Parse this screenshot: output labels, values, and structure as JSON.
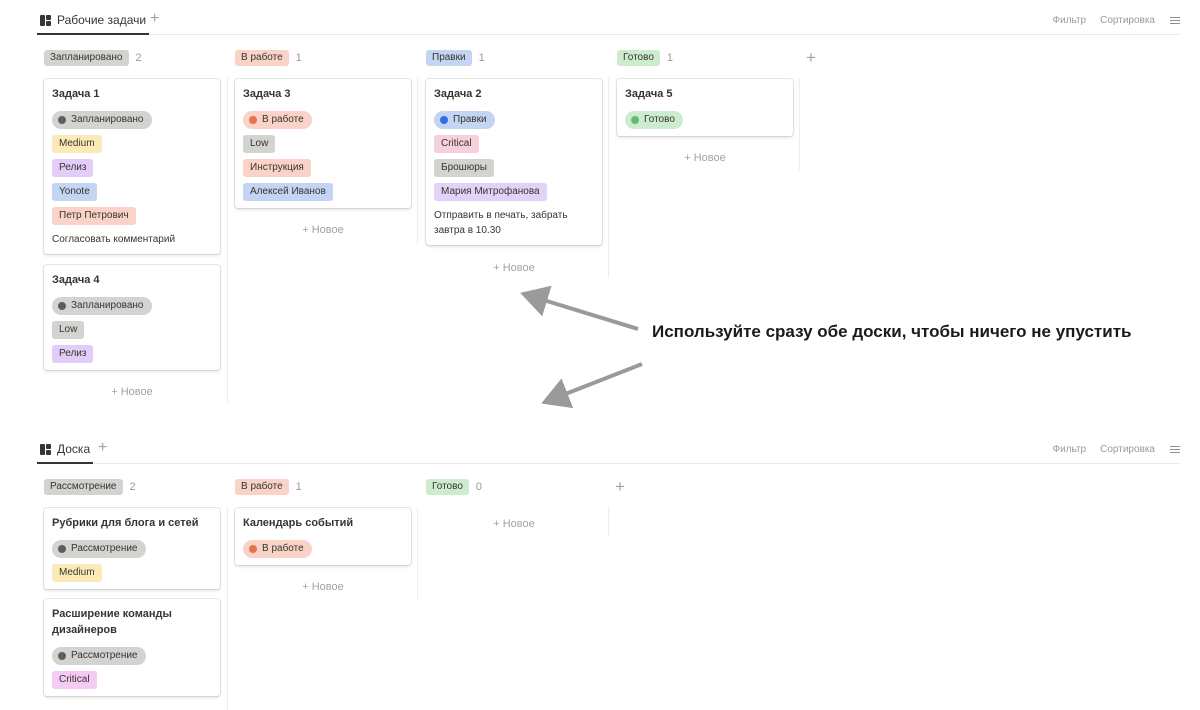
{
  "board1": {
    "tab_label": "Рабочие задачи",
    "add_view_label": "+",
    "filter_label": "Фильтр",
    "sort_label": "Сортировка",
    "add_group_label": "+",
    "new_label": "+ Новое",
    "columns": [
      {
        "name": "Запланировано",
        "count": "2",
        "color": "#d3d3d1"
      },
      {
        "name": "В работе",
        "count": "1",
        "color": "#f9d3c7"
      },
      {
        "name": "Правки",
        "count": "1",
        "color": "#c3d5f3"
      },
      {
        "name": "Готово",
        "count": "1",
        "color": "#cdeccf"
      }
    ],
    "cards": [
      {
        "title": "Задача 1",
        "status": "Запланировано",
        "priority": "Medium",
        "type": "Релиз",
        "project": "Yonote",
        "assignee": "Петр Петрович",
        "note": "Согласовать комментарий"
      },
      {
        "title": "Задача 4",
        "status": "Запланировано",
        "priority": "Low",
        "type": "Релиз"
      },
      {
        "title": "Задача 3",
        "status": "В работе",
        "priority": "Low",
        "type": "Инструкция",
        "assignee": "Алексей Иванов"
      },
      {
        "title": "Задача 2",
        "status": "Правки",
        "priority": "Critical",
        "type": "Брошюры",
        "assignee": "Мария Митрофанова",
        "note": "Отправить в печать, забрать завтра в 10.30"
      },
      {
        "title": "Задача 5",
        "status": "Готово"
      }
    ]
  },
  "board2": {
    "tab_label": "Доска",
    "add_view_label": "+",
    "filter_label": "Фильтр",
    "sort_label": "Сортировка",
    "add_group_label": "+",
    "new_label": "+ Новое",
    "columns": [
      {
        "name": "Рассмотрение",
        "count": "2",
        "color": "#d3d3d1"
      },
      {
        "name": "В работе",
        "count": "1",
        "color": "#f9d3c7"
      },
      {
        "name": "Готово",
        "count": "0",
        "color": "#cdeccf"
      }
    ],
    "cards": [
      {
        "title": "Рубрики для блога и сетей",
        "status": "Рассмотрение",
        "priority": "Medium"
      },
      {
        "title": "Расширение команды дизайнеров",
        "status": "Рассмотрение",
        "priority": "Critical"
      },
      {
        "title": "Календарь событий",
        "status": "В работе"
      }
    ]
  },
  "callout": "Используйте сразу обе доски, чтобы ничего не упустить",
  "colors": {
    "gray_tag": "#d3d3d1",
    "gray_status_bg": "#d3d3d1",
    "gray_dot": "#5f5e5b",
    "medium": "#fbe9b7",
    "low": "#d3d3d1",
    "release": "#e1cdf7",
    "project_blue": "#c3d5f3",
    "orange": "#f9d3c7",
    "orange_dot": "#e8734a",
    "blue_dot": "#2f6fe4",
    "critical_pink": "#f8cfdc",
    "critical_magenta": "#f6cbf3",
    "green": "#cdeccf",
    "green_dot": "#5cbf70",
    "lilac": "#e3d2f7",
    "arrow": "#9a9a9a"
  }
}
